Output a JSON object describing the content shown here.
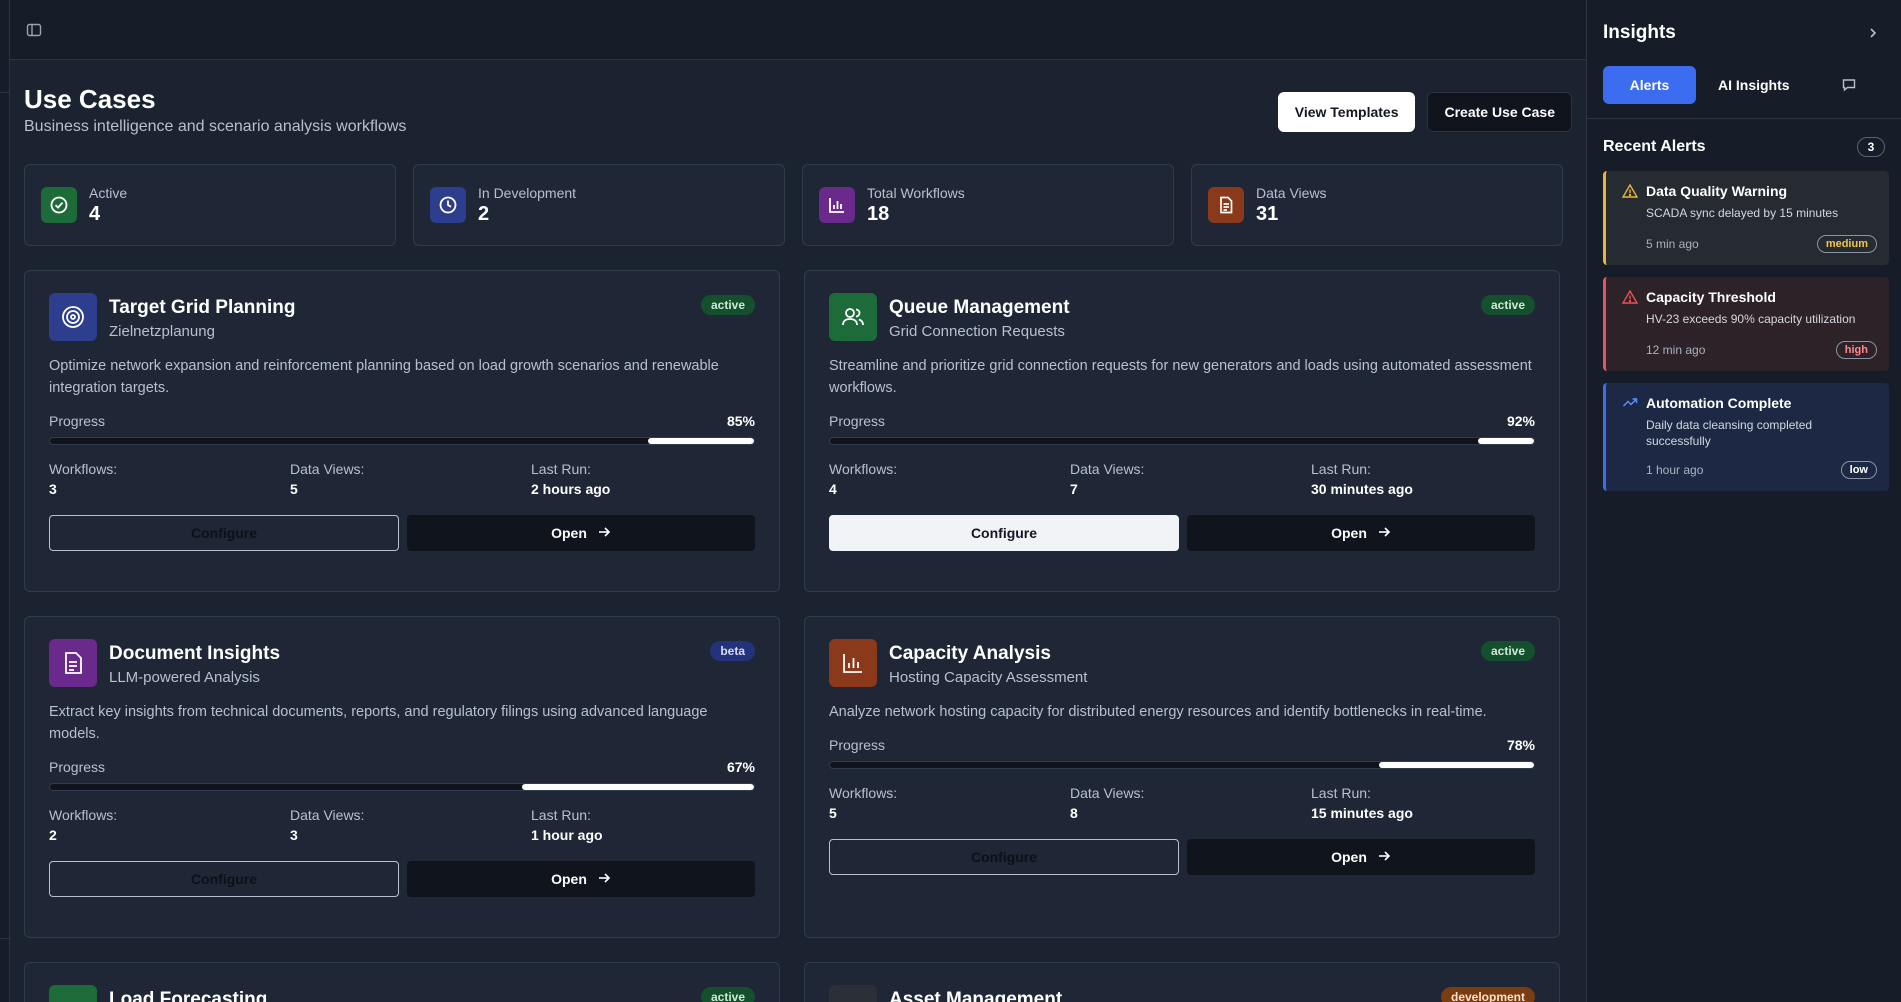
{
  "page": {
    "title": "Use Cases",
    "subtitle": "Business intelligence and scenario analysis workflows",
    "view_templates": "View Templates",
    "create_use_case": "Create Use Case"
  },
  "stats": [
    {
      "label": "Active",
      "value": "4",
      "icon": "check-circle-icon",
      "color": "#1e6b3a"
    },
    {
      "label": "In Development",
      "value": "2",
      "icon": "clock-icon",
      "color": "#2e3e8f"
    },
    {
      "label": "Total Workflows",
      "value": "18",
      "icon": "bar-chart-icon",
      "color": "#6a2a8c"
    },
    {
      "label": "Data Views",
      "value": "31",
      "icon": "document-icon",
      "color": "#8a3a1a"
    }
  ],
  "cards": [
    {
      "title": "Target Grid Planning",
      "subtitle": "Zielnetzplanung",
      "badge": "active",
      "icon": "target-icon",
      "color": "#2e3e8f",
      "description": "Optimize network expansion and reinforcement planning based on load growth scenarios and renewable integration targets.",
      "progress_label": "Progress",
      "progress": 0.85,
      "progress_text": "85%",
      "workflows_label": "Workflows:",
      "workflows": "3",
      "views_label": "Data Views:",
      "views": "5",
      "run_label": "Last Run:",
      "last_run": "2 hours ago",
      "configure": "Configure",
      "open": "Open"
    },
    {
      "title": "Queue Management",
      "subtitle": "Grid Connection Requests",
      "badge": "active",
      "icon": "users-icon",
      "color": "#1e6b3a",
      "description": "Streamline and prioritize grid connection requests for new generators and loads using automated assessment workflows.",
      "progress_label": "Progress",
      "progress": 0.92,
      "progress_text": "92%",
      "workflows_label": "Workflows:",
      "workflows": "4",
      "views_label": "Data Views:",
      "views": "7",
      "run_label": "Last Run:",
      "last_run": "30 minutes ago",
      "configure": "Configure",
      "open": "Open"
    },
    {
      "title": "Document Insights",
      "subtitle": "LLM-powered Analysis",
      "badge": "beta",
      "icon": "document-icon",
      "color": "#6a2a8c",
      "description": "Extract key insights from technical documents, reports, and regulatory filings using advanced language models.",
      "progress_label": "Progress",
      "progress": 0.67,
      "progress_text": "67%",
      "workflows_label": "Workflows:",
      "workflows": "2",
      "views_label": "Data Views:",
      "views": "3",
      "run_label": "Last Run:",
      "last_run": "1 hour ago",
      "configure": "Configure",
      "open": "Open"
    },
    {
      "title": "Capacity Analysis",
      "subtitle": "Hosting Capacity Assessment",
      "badge": "active",
      "icon": "bar-chart-icon",
      "color": "#8a3a1a",
      "description": "Analyze network hosting capacity for distributed energy resources and identify bottlenecks in real-time.",
      "progress_label": "Progress",
      "progress": 0.78,
      "progress_text": "78%",
      "workflows_label": "Workflows:",
      "workflows": "5",
      "views_label": "Data Views:",
      "views": "8",
      "run_label": "Last Run:",
      "last_run": "15 minutes ago",
      "configure": "Configure",
      "open": "Open"
    }
  ],
  "peek_cards": [
    {
      "title": "Load Forecasting",
      "badge": "active",
      "color": "#1e6b3a"
    },
    {
      "title": "Asset Management",
      "badge": "development",
      "color": "#2a2f38"
    }
  ],
  "sidebar": {
    "title": "Insights",
    "tab_alerts": "Alerts",
    "tab_ai": "AI Insights",
    "recent_title": "Recent Alerts",
    "recent_count": "3",
    "alerts": [
      {
        "title": "Data Quality Warning",
        "desc": "SCADA sync delayed by 15 minutes",
        "time": "5 min ago",
        "severity": "medium",
        "color": "#e8b53a"
      },
      {
        "title": "Capacity Threshold",
        "desc": "HV-23 exceeds 90% capacity utilization",
        "time": "12 min ago",
        "severity": "high",
        "color": "#e8525a"
      },
      {
        "title": "Automation Complete",
        "desc": "Daily data cleansing completed successfully",
        "time": "1 hour ago",
        "severity": "low",
        "color": "#5b8cff"
      }
    ]
  }
}
